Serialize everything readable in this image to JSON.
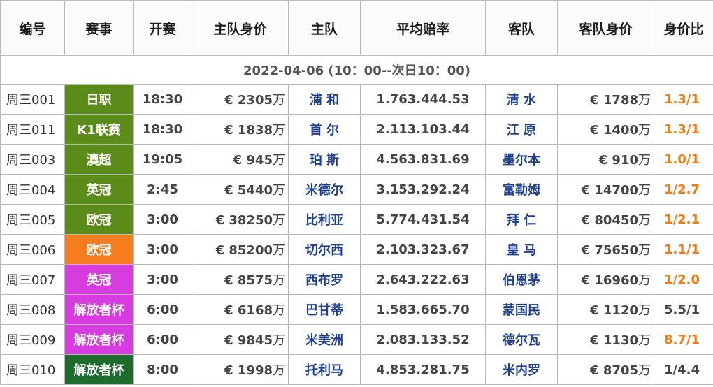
{
  "headers": [
    "编号",
    "赛事",
    "开赛",
    "主队身价",
    "主队",
    "平均赔率",
    "客队",
    "客队身价",
    "身价比"
  ],
  "date_range": "2022-04-06 (10：00--次日10：00)",
  "currency": "€",
  "unit": "万",
  "rows": [
    {
      "id": "周三001",
      "league": "日职",
      "league_color": "#5b8c1a",
      "time": "18:30",
      "home_value": "2305",
      "home": "浦  和",
      "odds": "1.763.444.53",
      "away": "清  水",
      "away_value": "1788",
      "ratio": "1.3/1",
      "ratio_color": "#f07d12"
    },
    {
      "id": "周三011",
      "league": "K1联赛",
      "league_color": "#5b8c1a",
      "time": "18:30",
      "home_value": "1838",
      "home": "首  尔",
      "odds": "2.113.103.44",
      "away": "江  原",
      "away_value": "1400",
      "ratio": "1.3/1",
      "ratio_color": "#f07d12"
    },
    {
      "id": "周三003",
      "league": "澳超",
      "league_color": "#5b8c1a",
      "time": "19:05",
      "home_value": "945",
      "home": "珀  斯",
      "odds": "4.563.831.69",
      "away": "墨尔本",
      "away_value": "910",
      "ratio": "1.0/1",
      "ratio_color": "#f07d12"
    },
    {
      "id": "周三004",
      "league": "英冠",
      "league_color": "#5b8c1a",
      "time": "2:45",
      "home_value": "5440",
      "home": "米德尔",
      "odds": "3.153.292.24",
      "away": "富勒姆",
      "away_value": "14700",
      "ratio": "1/2.7",
      "ratio_color": "#f07d12"
    },
    {
      "id": "周三005",
      "league": "欧冠",
      "league_color": "#5b8c1a",
      "time": "3:00",
      "home_value": "38250",
      "home": "比利亚",
      "odds": "5.774.431.54",
      "away": "拜  仁",
      "away_value": "80450",
      "ratio": "1/2.1",
      "ratio_color": "#f07d12"
    },
    {
      "id": "周三006",
      "league": "欧冠",
      "league_color": "#f57c1f",
      "time": "3:00",
      "home_value": "85200",
      "home": "切尔西",
      "odds": "2.103.323.67",
      "away": "皇  马",
      "away_value": "75650",
      "ratio": "1.1/1",
      "ratio_color": "#f07d12"
    },
    {
      "id": "周三007",
      "league": "英冠",
      "league_color": "#d63cde",
      "time": "3:00",
      "home_value": "8575",
      "home": "西布罗",
      "odds": "2.643.222.63",
      "away": "伯恩茅",
      "away_value": "16960",
      "ratio": "1/2.0",
      "ratio_color": "#f07d12"
    },
    {
      "id": "周三008",
      "league": "解放者杯",
      "league_color": "#d63cde",
      "time": "6:00",
      "home_value": "6168",
      "home": "巴甘蒂",
      "odds": "1.583.665.70",
      "away": "蒙国民",
      "away_value": "1120",
      "ratio": "5.5/1",
      "ratio_color": "#444444"
    },
    {
      "id": "周三009",
      "league": "解放者杯",
      "league_color": "#d63cde",
      "time": "6:00",
      "home_value": "9845",
      "home": "米美洲",
      "odds": "2.083.133.52",
      "away": "德尔瓦",
      "away_value": "1130",
      "ratio": "8.7/1",
      "ratio_color": "#f07d12"
    },
    {
      "id": "周三010",
      "league": "解放者杯",
      "league_color": "#1e6b2e",
      "time": "8:00",
      "home_value": "1998",
      "home": "托利马",
      "odds": "4.853.281.75",
      "away": "米内罗",
      "away_value": "8705",
      "ratio": "1/4.4",
      "ratio_color": "#444444"
    }
  ]
}
